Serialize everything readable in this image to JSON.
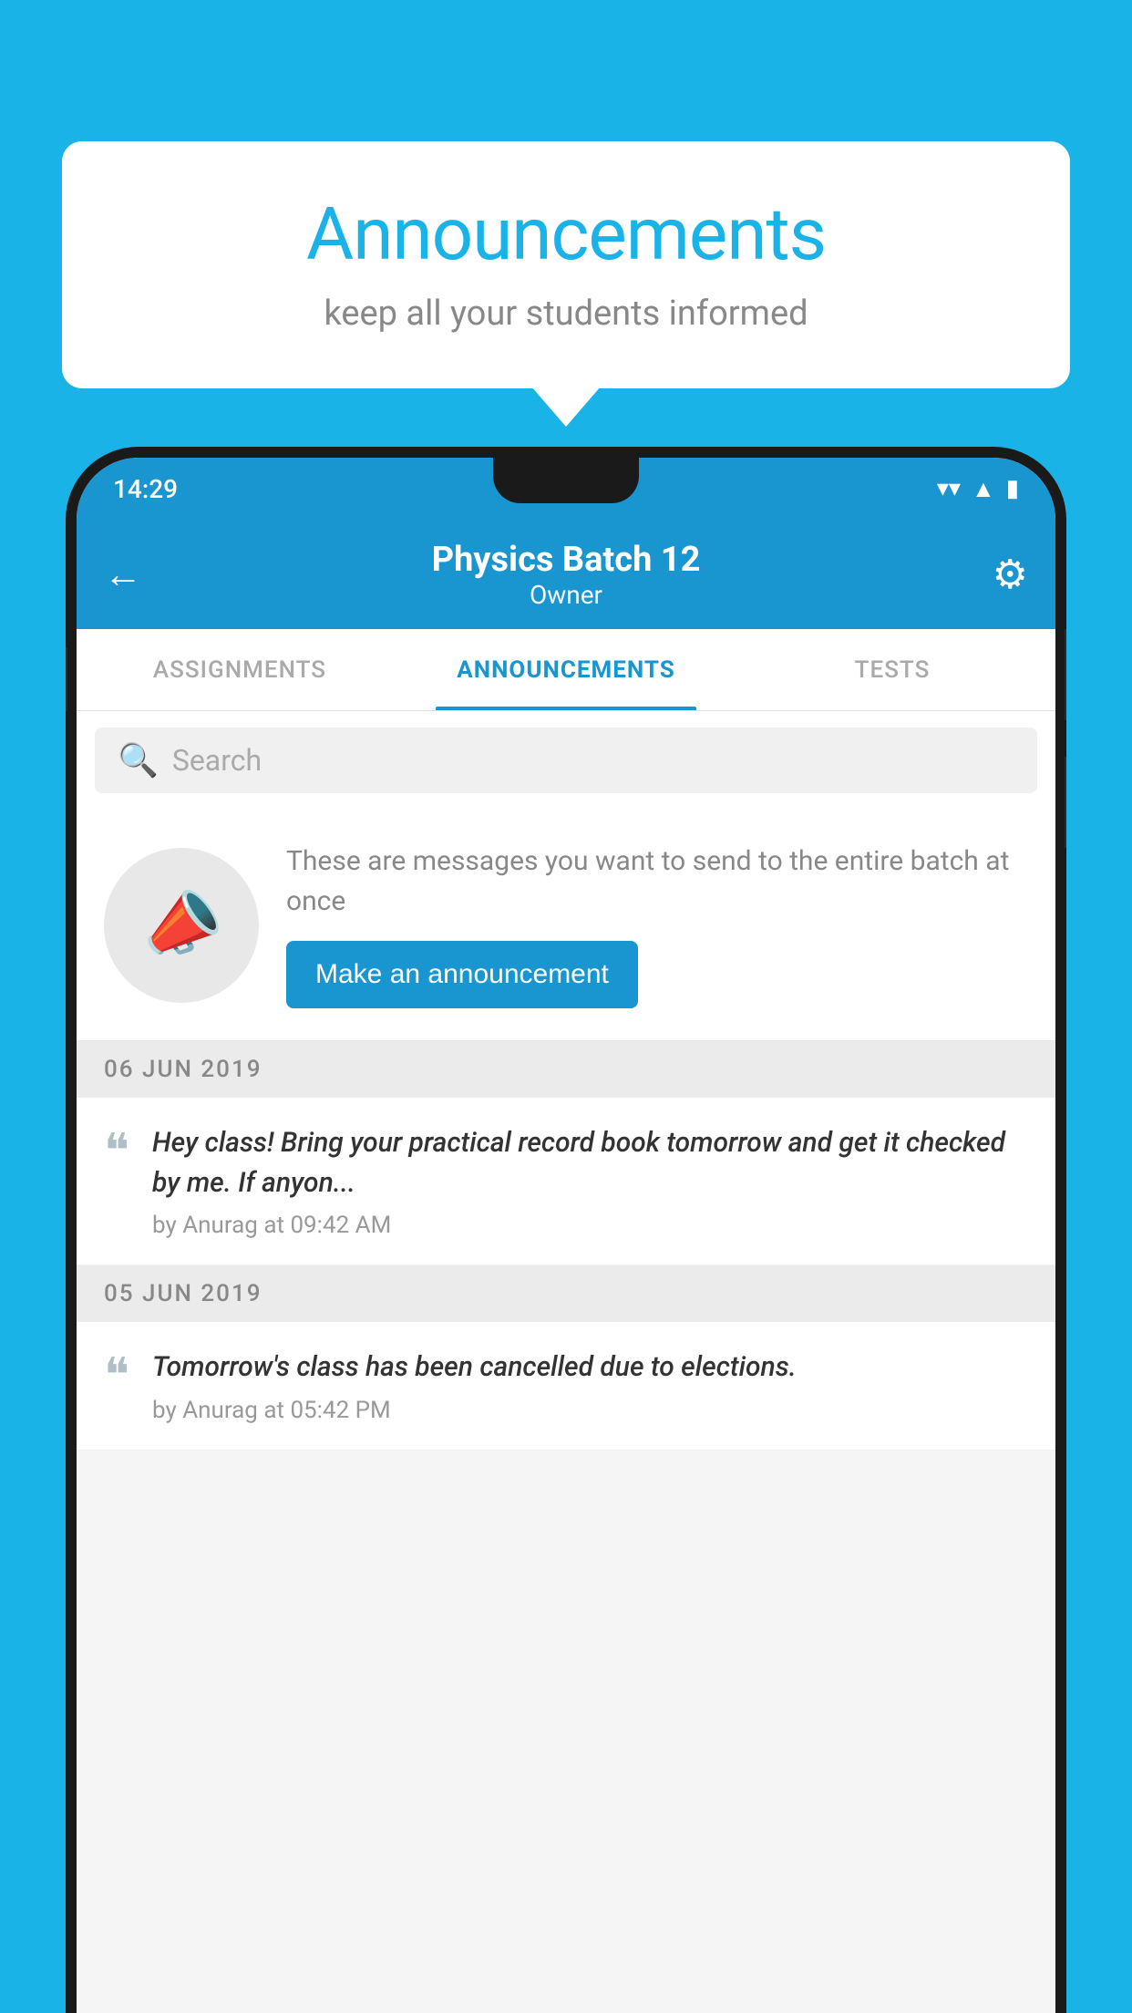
{
  "page": {
    "background_color": "#1ab3e8"
  },
  "speech_bubble": {
    "title": "Announcements",
    "subtitle": "keep all your students informed"
  },
  "phone": {
    "status_bar": {
      "time": "14:29",
      "wifi_icon": "▾",
      "signal_icon": "▲",
      "battery_icon": "▮"
    },
    "app_bar": {
      "back_icon": "←",
      "title": "Physics Batch 12",
      "subtitle": "Owner",
      "settings_icon": "⚙"
    },
    "tabs": [
      {
        "label": "ASSIGNMENTS",
        "active": false
      },
      {
        "label": "ANNOUNCEMENTS",
        "active": true
      },
      {
        "label": "TESTS",
        "active": false
      }
    ],
    "search": {
      "placeholder": "Search"
    },
    "promo": {
      "description": "These are messages you want to send to the entire batch at once",
      "button_label": "Make an announcement"
    },
    "announcements": [
      {
        "date": "06  JUN  2019",
        "message": "Hey class! Bring your practical record book tomorrow and get it checked by me. If anyon...",
        "meta": "by Anurag at 09:42 AM"
      },
      {
        "date": "05  JUN  2019",
        "message": "Tomorrow's class has been cancelled due to elections.",
        "meta": "by Anurag at 05:42 PM"
      }
    ]
  }
}
